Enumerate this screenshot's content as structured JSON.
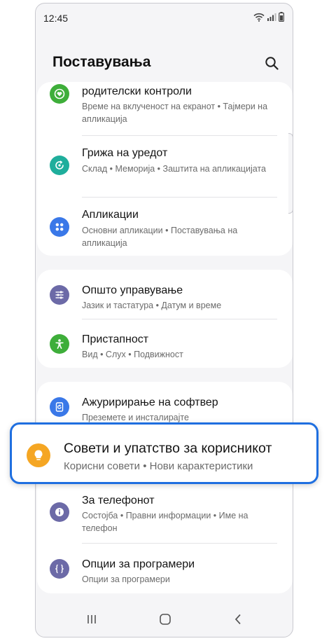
{
  "status_bar": {
    "time": "12:45"
  },
  "header": {
    "title": "Поставувања"
  },
  "colors": {
    "accent": "#1f6fe0",
    "parental_green": "#3eae3a",
    "device_care_teal": "#1fae9c",
    "apps_blue": "#3a78e8",
    "general_purple": "#6c6aa7",
    "accessibility_green": "#3eae3a",
    "update_blue": "#3a78e8",
    "tips_orange": "#f5a623"
  },
  "groups": [
    {
      "items": [
        {
          "title": "родителски контроли",
          "subtitle": "Време на вклученост на екранот  •  Тајмери на апликација",
          "icon": "parental-heart-icon"
        },
        {
          "title": "Грижа на уредот",
          "subtitle": "Склад  •  Меморија  •  Заштита на апликацијата",
          "icon": "device-care-icon"
        },
        {
          "title": "Апликации",
          "subtitle": "Основни апликации  •  Поставувања на апликација",
          "icon": "apps-grid-icon"
        }
      ]
    },
    {
      "items": [
        {
          "title": "Општо управување",
          "subtitle": "Јазик и тастатура  •  Датум и време",
          "icon": "sliders-icon"
        },
        {
          "title": "Пристапност",
          "subtitle": "Вид  •  Слух  •  Подвижност",
          "icon": "accessibility-person-icon"
        }
      ]
    },
    {
      "items": [
        {
          "title": "Ажуририрање на софтвер",
          "subtitle": "Преземете и инсталирајте",
          "icon": "update-icon"
        },
        {
          "title": "За телефонот",
          "subtitle": "Состојба  •  Правни информации  •  Име на телефон",
          "icon": "info-icon"
        },
        {
          "title": "Опции за програмери",
          "subtitle": "Опции за програмери",
          "icon": "code-braces-icon"
        }
      ]
    }
  ],
  "highlighted": {
    "title": "Совети и упатство за корисникот",
    "subtitle": "Корисни совети  •  Нови карактеристики",
    "icon": "lightbulb-icon"
  }
}
